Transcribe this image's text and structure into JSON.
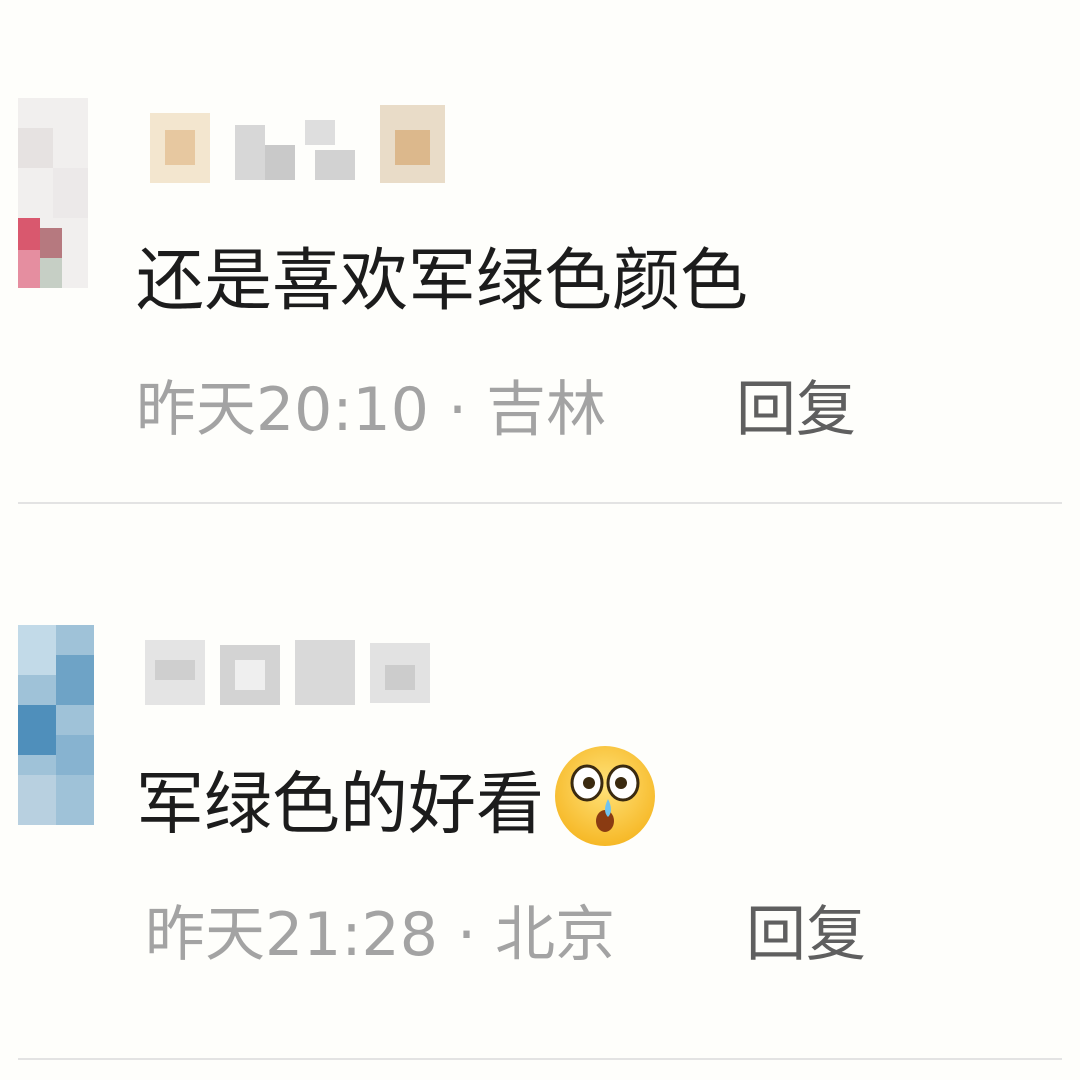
{
  "comments": [
    {
      "text": "还是喜欢军绿色颜色",
      "time": "昨天20:10",
      "separator": "·",
      "location": "吉林",
      "reply_label": "回复"
    },
    {
      "text": "军绿色的好看",
      "emoji": "surprised-tear-emoji",
      "time": "昨天21:28",
      "separator": "·",
      "location": "北京",
      "reply_label": "回复"
    }
  ]
}
